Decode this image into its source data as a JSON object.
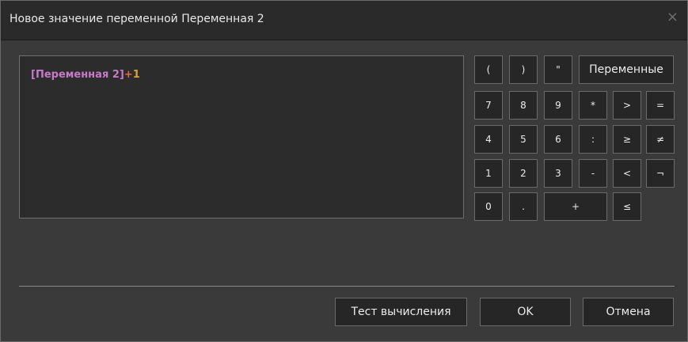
{
  "window": {
    "title": "Новое значение переменной Переменная 2",
    "close_glyph": "×"
  },
  "expression": {
    "variable": "[Переменная 2]",
    "operator": "+",
    "number": "1"
  },
  "keypad": {
    "open_paren": "(",
    "close_paren": ")",
    "quote": "\"",
    "variables": "Переменные",
    "seven": "7",
    "eight": "8",
    "nine": "9",
    "multiply": "*",
    "greater": ">",
    "equals": "=",
    "four": "4",
    "five": "5",
    "six": "6",
    "divide": ":",
    "greater_equal": "≥",
    "not_equal": "≠",
    "one": "1",
    "two": "2",
    "three": "3",
    "minus": "-",
    "less": "<",
    "not": "¬",
    "zero": "0",
    "dot": ".",
    "plus": "+",
    "less_equal": "≤"
  },
  "footer": {
    "test_label": "Тест вычисления",
    "ok_label": "OK",
    "cancel_label": "Отмена"
  },
  "colors": {
    "variable": "#c879c8",
    "operator": "#e46a3a",
    "number": "#e0a030"
  }
}
